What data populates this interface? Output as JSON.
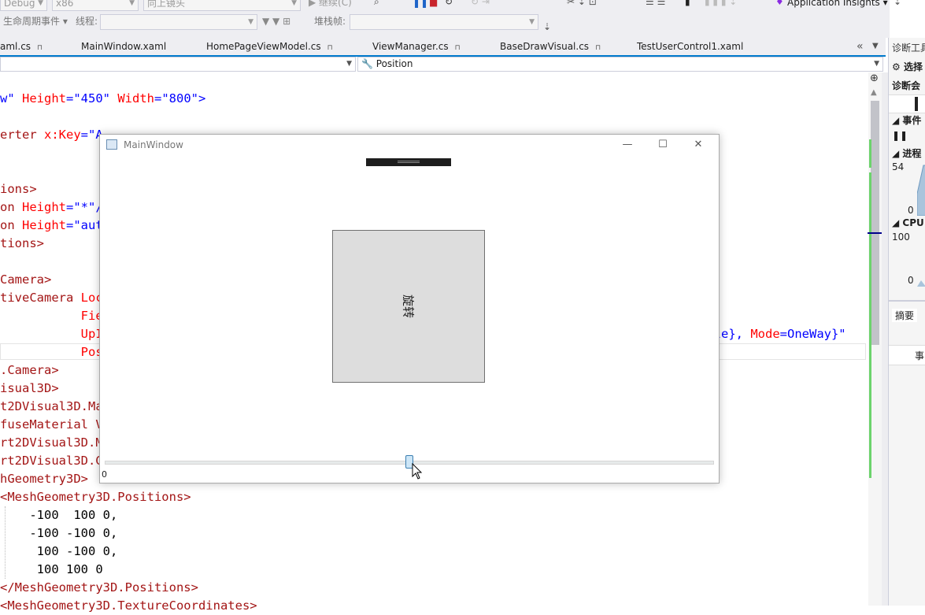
{
  "toolbar": {
    "config": "Debug",
    "platform": "x86",
    "camera_combo": "向上镜头",
    "continue_label": "继续(C)",
    "app_insights": "Application Insights",
    "lifecycle_label": "生命周期事件",
    "thread_label": "线程:",
    "stack_label": "堆栈帧:"
  },
  "tabs": [
    {
      "label": "aml.cs"
    },
    {
      "label": "MainWindow.xaml"
    },
    {
      "label": "HomePageViewModel.cs"
    },
    {
      "label": "ViewManager.cs"
    },
    {
      "label": "BaseDrawVisual.cs"
    },
    {
      "label": "TestUserControl1.xaml"
    }
  ],
  "nav": {
    "member": "Position"
  },
  "code": {
    "l1a": "w\" ",
    "l1b": "Height",
    "l1c": "=\"450\" ",
    "l1d": "Width",
    "l1e": "=\"800\">",
    "l2a": "erter ",
    "l2b": "x:Key",
    "l2c": "=\"A",
    "l3": "ions>",
    "l4a": "on ",
    "l4b": "Height",
    "l4c": "=\"*\"/",
    "l5a": "on ",
    "l5b": "Height",
    "l5c": "=\"aut",
    "l6": "tions>",
    "l7": "Camera>",
    "l8a": "tiveCamera ",
    "l8b": "Loc",
    "l9": "           Fie",
    "l10a": "           UpI",
    "l10b": "ngle}, ",
    "l10c": "Mode",
    "l10d": "=OneWay}\"",
    "l11": "           Pos",
    "l12": ".Camera>",
    "l13": "isual3D>",
    "l14": "t2DVisual3D.Ma",
    "l15": "fuseMaterial V",
    "l16": "rt2DVisual3D.M",
    "l17": "rt2DVisual3D.Ge",
    "l18": "hGeometry3D>",
    "l19": "<MeshGeometry3D.Positions>",
    "l20": "    -100  100 0,",
    "l21": "    -100 -100 0,",
    "l22": "     100 -100 0,",
    "l23": "     100 100 0",
    "l24": "</MeshGeometry3D.Positions>",
    "l25": "<MeshGeometry3D.TextureCoordinates>"
  },
  "right_panel": {
    "title": "诊断工具",
    "select": "选择",
    "session": "诊断会",
    "events": "事件",
    "process": "进程",
    "p_max": "54",
    "p_min": "0",
    "cpu": "CPU",
    "cpu_max": "100",
    "cpu_min": "0",
    "summary": "摘要",
    "event_col": "事"
  },
  "window": {
    "title": "MainWindow",
    "rotate_label": "旋转",
    "slider_value": "0"
  }
}
